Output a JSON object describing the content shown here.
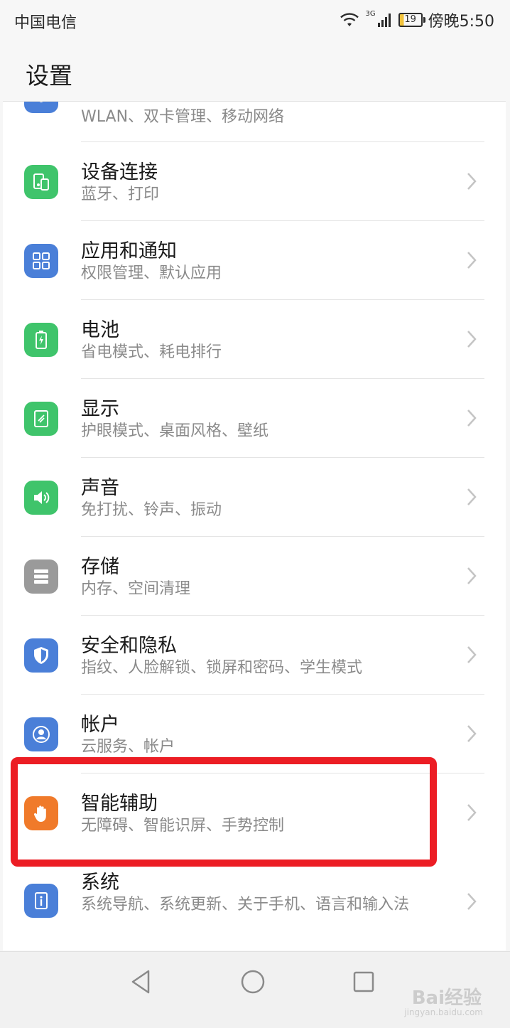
{
  "status_bar": {
    "carrier": "中国电信",
    "network_type": "3G",
    "battery": "19",
    "time": "傍晚5:50"
  },
  "header": {
    "title": "设置"
  },
  "items": [
    {
      "title": "",
      "subtitle": "WLAN、双卡管理、移动网络",
      "icon": "network-icon",
      "color": "#4a7fd8"
    },
    {
      "title": "设备连接",
      "subtitle": "蓝牙、打印",
      "icon": "device-connection-icon",
      "color": "#3fc46b"
    },
    {
      "title": "应用和通知",
      "subtitle": "权限管理、默认应用",
      "icon": "apps-grid-icon",
      "color": "#4a7fd8"
    },
    {
      "title": "电池",
      "subtitle": "省电模式、耗电排行",
      "icon": "battery-icon",
      "color": "#3fc46b"
    },
    {
      "title": "显示",
      "subtitle": "护眼模式、桌面风格、壁纸",
      "icon": "display-icon",
      "color": "#3fc46b"
    },
    {
      "title": "声音",
      "subtitle": "免打扰、铃声、振动",
      "icon": "speaker-icon",
      "color": "#3fc46b"
    },
    {
      "title": "存储",
      "subtitle": "内存、空间清理",
      "icon": "storage-icon",
      "color": "#9a9a9a"
    },
    {
      "title": "安全和隐私",
      "subtitle": "指纹、人脸解锁、锁屏和密码、学生模式",
      "icon": "shield-icon",
      "color": "#4a7fd8"
    },
    {
      "title": "帐户",
      "subtitle": "云服务、帐户",
      "icon": "account-icon",
      "color": "#4a7fd8"
    },
    {
      "title": "智能辅助",
      "subtitle": "无障碍、智能识屏、手势控制",
      "icon": "hand-icon",
      "color": "#f07a2a"
    },
    {
      "title": "系统",
      "subtitle": "系统导航、系统更新、关于手机、语言和输入法",
      "icon": "info-icon",
      "color": "#4a7fd8"
    }
  ],
  "highlight_color": "#ec1d24",
  "nav_bar": {
    "back": "back-icon",
    "home": "home-icon",
    "recents": "recents-icon"
  },
  "watermark": {
    "text": "Bai经验",
    "url": "jingyan.baidu.com"
  }
}
